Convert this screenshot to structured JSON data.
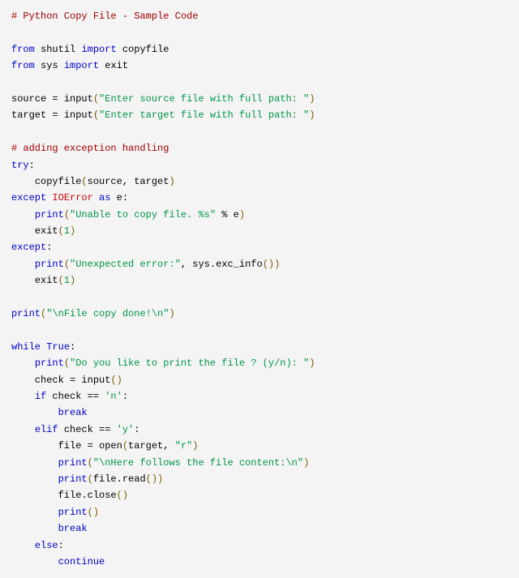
{
  "code": {
    "l1": "# Python Copy File - Sample Code",
    "l3a": "from",
    "l3b": "shutil",
    "l3c": "import",
    "l3d": "copyfile",
    "l4a": "from",
    "l4b": "sys",
    "l4c": "import",
    "l4d": "exit",
    "l6a": "source",
    "l6b": " = ",
    "l6c": "input",
    "l6d": "(",
    "l6e": "\"Enter source file with full path: \"",
    "l6f": ")",
    "l7a": "target",
    "l7b": " = ",
    "l7c": "input",
    "l7d": "(",
    "l7e": "\"Enter target file with full path: \"",
    "l7f": ")",
    "l9": "# adding exception handling",
    "l10a": "try",
    "l10b": ":",
    "l11a": "    ",
    "l11b": "copyfile",
    "l11c": "(",
    "l11d": "source, target",
    "l11e": ")",
    "l12a": "except",
    "l12b": " ",
    "l12c": "IOError",
    "l12d": " ",
    "l12e": "as",
    "l12f": " e:",
    "l13a": "    ",
    "l13b": "print",
    "l13c": "(",
    "l13d": "\"Unable to copy file. %s\"",
    "l13e": " % e",
    "l13f": ")",
    "l14a": "    ",
    "l14b": "exit",
    "l14c": "(",
    "l14d": "1",
    "l14e": ")",
    "l15a": "except",
    "l15b": ":",
    "l16a": "    ",
    "l16b": "print",
    "l16c": "(",
    "l16d": "\"Unexpected error:\"",
    "l16e": ", sys.exc_info",
    "l16f": "()",
    "l16g": ")",
    "l17a": "    ",
    "l17b": "exit",
    "l17c": "(",
    "l17d": "1",
    "l17e": ")",
    "l19a": "print",
    "l19b": "(",
    "l19c": "\"\\nFile copy done!\\n\"",
    "l19d": ")",
    "l21a": "while",
    "l21b": " ",
    "l21c": "True",
    "l21d": ":",
    "l22a": "    ",
    "l22b": "print",
    "l22c": "(",
    "l22d": "\"Do you like to print the file ? (y/n): \"",
    "l22e": ")",
    "l23a": "    check = ",
    "l23b": "input",
    "l23c": "()",
    "l24a": "    ",
    "l24b": "if",
    "l24c": " check == ",
    "l24d": "'n'",
    "l24e": ":",
    "l25a": "        ",
    "l25b": "break",
    "l26a": "    ",
    "l26b": "elif",
    "l26c": " check == ",
    "l26d": "'y'",
    "l26e": ":",
    "l27a": "        file = ",
    "l27b": "open",
    "l27c": "(",
    "l27d": "target, ",
    "l27e": "\"r\"",
    "l27f": ")",
    "l28a": "        ",
    "l28b": "print",
    "l28c": "(",
    "l28d": "\"\\nHere follows the file content:\\n\"",
    "l28e": ")",
    "l29a": "        ",
    "l29b": "print",
    "l29c": "(",
    "l29d": "file.read",
    "l29e": "()",
    "l29f": ")",
    "l30a": "        file.close",
    "l30b": "()",
    "l31a": "        ",
    "l31b": "print",
    "l31c": "()",
    "l32a": "        ",
    "l32b": "break",
    "l33a": "    ",
    "l33b": "else",
    "l33c": ":",
    "l34a": "        ",
    "l34b": "continue"
  }
}
